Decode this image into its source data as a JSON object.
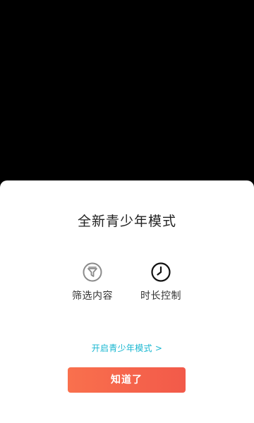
{
  "dialog": {
    "title": "全新青少年模式",
    "features": [
      {
        "label": "筛选内容",
        "icon": "filter-icon"
      },
      {
        "label": "时长控制",
        "icon": "clock-icon"
      }
    ],
    "enable_link": "开启青少年模式 >",
    "confirm_button": "知道了"
  },
  "colors": {
    "accent_link": "#19b7d1",
    "button_start": "#f9704d",
    "button_end": "#f25a4a",
    "background": "#000000",
    "sheet": "#ffffff"
  }
}
